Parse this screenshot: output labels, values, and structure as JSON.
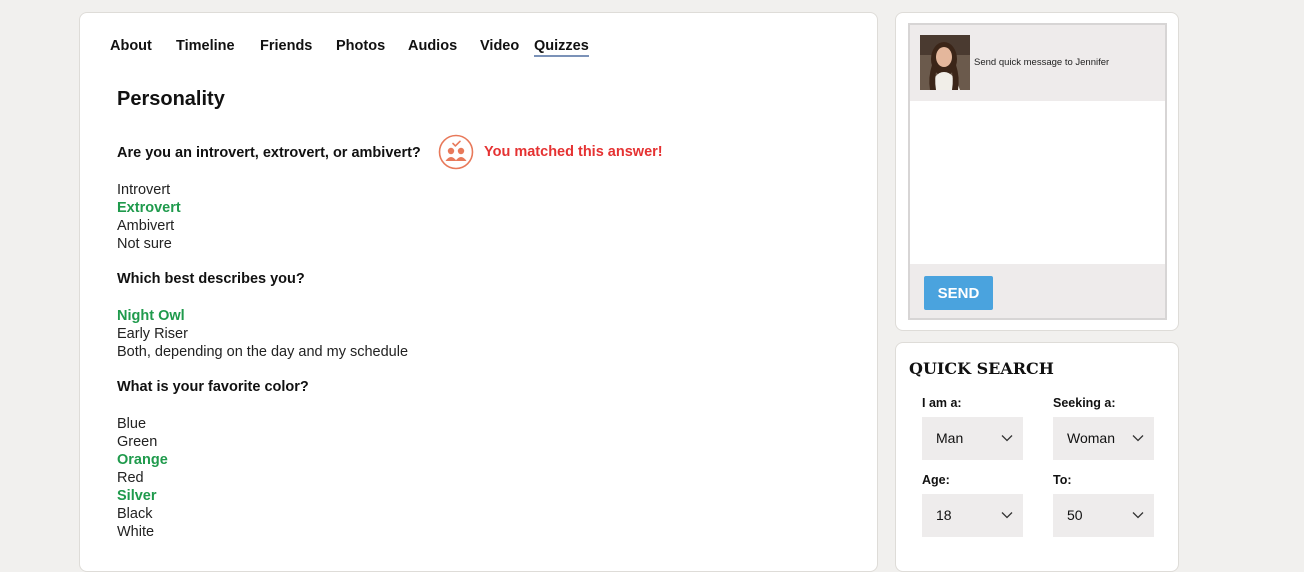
{
  "tabs": [
    "About",
    "Timeline",
    "Friends",
    "Photos",
    "Audios",
    "Video",
    "Quizzes"
  ],
  "active_tab": "Quizzes",
  "quiz": {
    "section_title": "Personality",
    "match_text": "You matched this answer!",
    "questions": [
      {
        "text": "Are you an introvert, extrovert, or ambivert?",
        "options": [
          "Introvert",
          "Extrovert",
          "Ambivert",
          "Not sure"
        ],
        "matched": [
          "Extrovert"
        ]
      },
      {
        "text": "Which best describes you?",
        "options": [
          "Night Owl",
          "Early Riser",
          "Both, depending on the day and my schedule"
        ],
        "matched": [
          "Night Owl"
        ]
      },
      {
        "text": "What is your favorite color?",
        "options": [
          "Blue",
          "Green",
          "Orange",
          "Red",
          "Silver",
          "Black",
          "White"
        ],
        "matched": [
          "Orange",
          "Silver"
        ]
      }
    ]
  },
  "message": {
    "label": "Send quick message to  Jennifer",
    "send_label": "SEND"
  },
  "search": {
    "title": "QUICK SEARCH",
    "i_am_label": "I am a:",
    "i_am_value": "Man",
    "seeking_label": "Seeking a:",
    "seeking_value": "Woman",
    "age_label": "Age:",
    "age_value": "18",
    "to_label": "To:",
    "to_value": "50"
  },
  "colors": {
    "matched": "#1f9a4c",
    "match_alert": "#e53232",
    "match_icon": "#e8795a",
    "send_button": "#4aa3de",
    "tab_underline": "#7b92b8"
  }
}
